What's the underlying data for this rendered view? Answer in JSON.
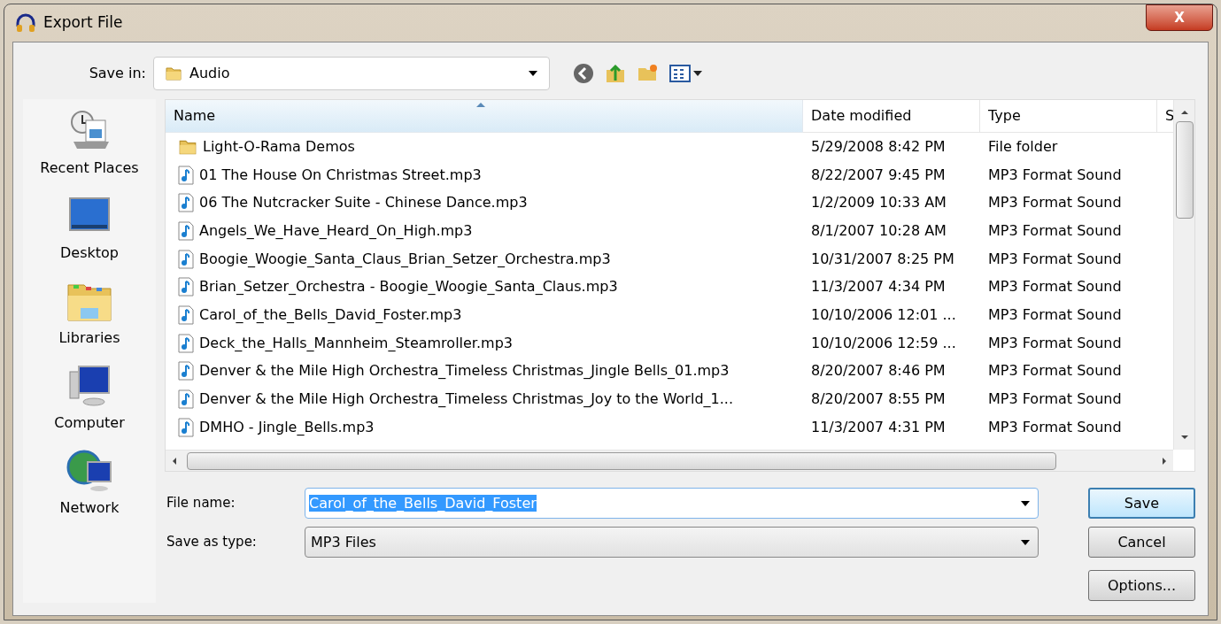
{
  "window": {
    "title": "Export File",
    "close_label": "X"
  },
  "save_in": {
    "label": "Save in:",
    "value": "Audio"
  },
  "places": [
    {
      "label": "Recent Places",
      "kind": "recent"
    },
    {
      "label": "Desktop",
      "kind": "desktop"
    },
    {
      "label": "Libraries",
      "kind": "libraries"
    },
    {
      "label": "Computer",
      "kind": "computer"
    },
    {
      "label": "Network",
      "kind": "network"
    }
  ],
  "table": {
    "columns": [
      {
        "label": "Name",
        "sorted": true
      },
      {
        "label": "Date modified",
        "sorted": false
      },
      {
        "label": "Type",
        "sorted": false
      },
      {
        "label": "S",
        "sorted": false
      }
    ],
    "rows": [
      {
        "kind": "folder",
        "name": "Light-O-Rama Demos",
        "date": "5/29/2008 8:42 PM",
        "type": "File folder"
      },
      {
        "kind": "audio",
        "name": "01 The House On Christmas Street.mp3",
        "date": "8/22/2007 9:45 PM",
        "type": "MP3 Format Sound"
      },
      {
        "kind": "audio",
        "name": "06 The Nutcracker Suite - Chinese Dance.mp3",
        "date": "1/2/2009 10:33 AM",
        "type": "MP3 Format Sound"
      },
      {
        "kind": "audio",
        "name": "Angels_We_Have_Heard_On_High.mp3",
        "date": "8/1/2007 10:28 AM",
        "type": "MP3 Format Sound"
      },
      {
        "kind": "audio",
        "name": "Boogie_Woogie_Santa_Claus_Brian_Setzer_Orchestra.mp3",
        "date": "10/31/2007 8:25 PM",
        "type": "MP3 Format Sound"
      },
      {
        "kind": "audio",
        "name": "Brian_Setzer_Orchestra - Boogie_Woogie_Santa_Claus.mp3",
        "date": "11/3/2007 4:34 PM",
        "type": "MP3 Format Sound"
      },
      {
        "kind": "audio",
        "name": "Carol_of_the_Bells_David_Foster.mp3",
        "date": "10/10/2006 12:01 ...",
        "type": "MP3 Format Sound"
      },
      {
        "kind": "audio",
        "name": "Deck_the_Halls_Mannheim_Steamroller.mp3",
        "date": "10/10/2006 12:59 ...",
        "type": "MP3 Format Sound"
      },
      {
        "kind": "audio",
        "name": "Denver & the Mile High Orchestra_Timeless Christmas_Jingle Bells_01.mp3",
        "date": "8/20/2007 8:46 PM",
        "type": "MP3 Format Sound"
      },
      {
        "kind": "audio",
        "name": "Denver & the Mile High Orchestra_Timeless Christmas_Joy to the World_1...",
        "date": "8/20/2007 8:55 PM",
        "type": "MP3 Format Sound"
      },
      {
        "kind": "audio",
        "name": "DMHO - Jingle_Bells.mp3",
        "date": "11/3/2007 4:31 PM",
        "type": "MP3 Format Sound"
      }
    ]
  },
  "file_name": {
    "label": "File name:",
    "value": "Carol_of_the_Bells_David_Foster",
    "value_selected": true
  },
  "save_as_type": {
    "label": "Save as type:",
    "value": "MP3 Files"
  },
  "buttons": [
    {
      "label": "Save",
      "default": true
    },
    {
      "label": "Cancel",
      "default": false
    },
    {
      "label": "Options...",
      "default": false
    }
  ]
}
